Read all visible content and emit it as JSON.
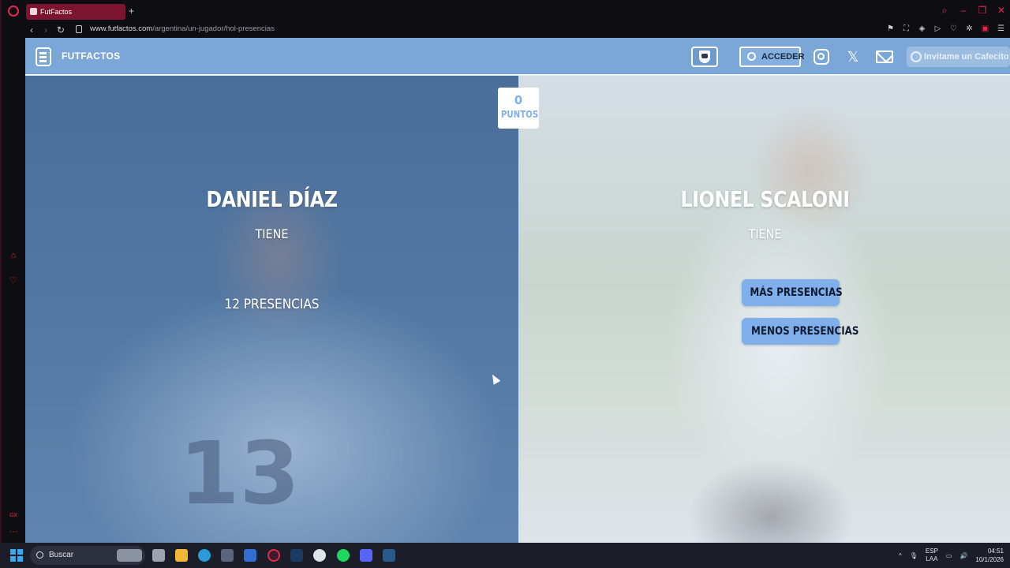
{
  "browser": {
    "tab_title": "FutFactos",
    "new_tab": "+",
    "url_domain": "www.futfactos.com",
    "url_path": "/argentina/un-jugador/hol-presencias"
  },
  "site": {
    "brand": "FUTFACTOS",
    "login_label": "ACCEDER",
    "cafecito_label": "Invitame un Cafecito",
    "x_glyph": "𝕏"
  },
  "score": {
    "value": "0",
    "label": "PUNTOS"
  },
  "left_player": {
    "name": "DANIEL DÍAZ",
    "verb": "TIENE",
    "value": "12 PRESENCIAS",
    "jersey": "13"
  },
  "right_player": {
    "name": "LIONEL SCALONI",
    "verb": "TIENE",
    "more_label": "MÁS PRESENCIAS",
    "less_label": "MENOS PRESENCIAS"
  },
  "taskbar": {
    "search_label": "Buscar",
    "lang_1": "ESP",
    "lang_2": "LAA",
    "time": "04:51",
    "date": "10/1/2026"
  },
  "colors": {
    "accent": "#7aa7d7",
    "button": "#7fb0ec",
    "opera_red": "#e5294e"
  }
}
